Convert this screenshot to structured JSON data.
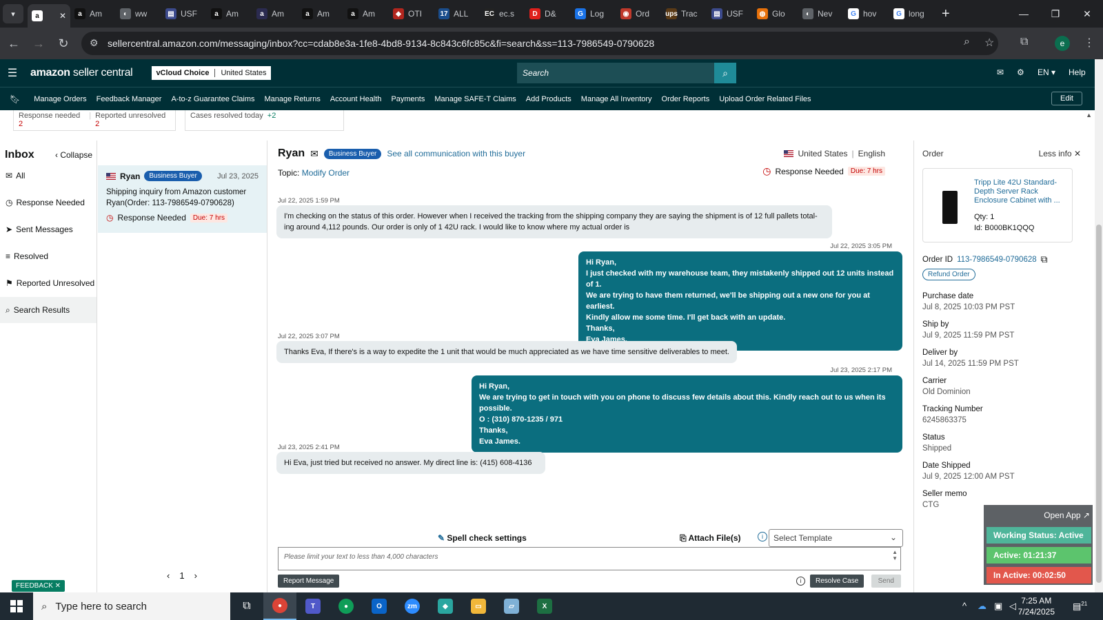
{
  "browser": {
    "tabs": [
      {
        "label": "Am",
        "icon": "a",
        "color": "#111111"
      },
      {
        "label": "ww",
        "icon": "◐",
        "color": "#5f6368"
      },
      {
        "label": "USF",
        "icon": "▤",
        "color": "#3c4a8c"
      },
      {
        "label": "Am",
        "icon": "a",
        "color": "#111111"
      },
      {
        "label": "Am",
        "icon": "a",
        "color": "#2b2b50"
      },
      {
        "label": "Am",
        "icon": "a",
        "color": "#111111"
      },
      {
        "label": "Am",
        "icon": "a",
        "color": "#111111"
      },
      {
        "label": "OTI",
        "icon": "◆",
        "color": "#b3261e"
      },
      {
        "label": "ALL",
        "icon": "17",
        "color": "#1a4d8c"
      },
      {
        "label": "ec.s",
        "icon": "EC",
        "color": "#222222"
      },
      {
        "label": "D&",
        "icon": "D",
        "color": "#e0201c"
      },
      {
        "label": "Log",
        "icon": "G",
        "color": "#1a73e8"
      },
      {
        "label": "Ord",
        "icon": "◉",
        "color": "#c0392b"
      },
      {
        "label": "Trac",
        "icon": "ups",
        "color": "#5a3a16"
      },
      {
        "label": "USF",
        "icon": "▤",
        "color": "#3c4a8c"
      },
      {
        "label": "Glo",
        "icon": "◍",
        "color": "#e8710a"
      },
      {
        "label": "Nev",
        "icon": "◐",
        "color": "#5f6368"
      },
      {
        "label": "hov",
        "icon": "G",
        "color": "#ffffff"
      },
      {
        "label": "long",
        "icon": "G",
        "color": "#ffffff"
      }
    ],
    "url": "sellercentral.amazon.com/messaging/inbox?cc=cdab8e3a-1fe8-4bd8-9134-8c843c6fc85c&fi=search&ss=113-7986549-0790628",
    "profile_initial": "e"
  },
  "header": {
    "logo_main": "amazon",
    "logo_sub": " seller central",
    "account_name": "vCloud Choice",
    "account_region": "United States",
    "search_placeholder": "Search",
    "language": "EN",
    "help": "Help"
  },
  "menu": {
    "items": [
      "Manage Orders",
      "Feedback Manager",
      "A-to-z Guarantee Claims",
      "Manage Returns",
      "Account Health",
      "Payments",
      "Manage SAFE-T Claims",
      "Add Products",
      "Manage All Inventory",
      "Order Reports",
      "Upload Order Related Files"
    ],
    "edit": "Edit"
  },
  "stats": {
    "response_needed_label": "Response needed",
    "response_needed_count": "2",
    "reported_unresolved_label": "Reported unresolved",
    "reported_unresolved_count": "2",
    "cases_resolved_label": "Cases resolved today",
    "cases_resolved_count": "+2"
  },
  "inbox": {
    "title": "Inbox",
    "collapse": "Collapse",
    "items": [
      {
        "label": "All",
        "icon": "✉"
      },
      {
        "label": "Response Needed",
        "icon": "◷"
      },
      {
        "label": "Sent Messages",
        "icon": "➤"
      },
      {
        "label": "Resolved",
        "icon": "≡"
      },
      {
        "label": "Reported Unresolved",
        "icon": "⚑"
      },
      {
        "label": "Search Results",
        "icon": "⌕"
      }
    ]
  },
  "thread": {
    "name": "Ryan",
    "badge": "Business Buyer",
    "date": "Jul 23, 2025",
    "snippet": "Shipping inquiry from Amazon customer Ryan(Order: 113-7986549-0790628)",
    "status": "Response Needed",
    "due": "Due: 7 hrs",
    "page": "1"
  },
  "feedback": "FEEDBACK ✕",
  "conversation": {
    "name": "Ryan",
    "badge": "Business Buyer",
    "see_all": "See all communication with this buyer",
    "topic_label": "Topic:",
    "topic": "Modify Order",
    "country": "United States",
    "language": "English",
    "status": "Response Needed",
    "due": "Due: 7 hrs",
    "messages": [
      {
        "ts": "Jul 22, 2025 1:59 PM",
        "text": "I'm checking on the status of this order. However when I received the tracking from the shipping company they are saying the shipment is of 12 full pallets total- ing around 4,112 pounds. Our order is only of 1 42U rack. I would like to know where my actual order is"
      },
      {
        "ts": "Jul 22, 2025 3:05 PM",
        "lines": [
          "Hi Ryan,",
          "I just checked with my warehouse team, they mistakenly shipped out 12 units instead of 1.",
          "We are trying to have them returned, we'll be shipping out a new one for you at earliest.",
          "Kindly allow me some time. I'll get back with an update.",
          "Thanks,",
          "Eva James."
        ]
      },
      {
        "ts": "Jul 22, 2025 3:07 PM",
        "text": "Thanks Eva, If there's is a way to expedite the 1 unit that would be much appreciated as we have time sensitive deliverables to meet."
      },
      {
        "ts": "Jul 23, 2025 2:17 PM",
        "lines": [
          "Hi Ryan,",
          "We are trying to get in touch with you on phone to discuss few details about this. Kindly reach out to us when its possible.",
          "O : (310) 870-1235 / 971",
          "Thanks,",
          "Eva James."
        ]
      },
      {
        "ts": "Jul 23, 2025 2:41 PM",
        "text": "Hi Eva, just tried but received no answer. My direct line is: (415) 608-4136"
      }
    ],
    "spell_check": "Spell check settings",
    "attach": "Attach File(s)",
    "template_placeholder": "Select Template",
    "textarea_placeholder": "Please limit your text to less than 4,000 characters",
    "report": "Report Message",
    "resolve": "Resolve Case",
    "send": "Send"
  },
  "order": {
    "title": "Order",
    "less_info": "Less info",
    "product_name": "Tripp Lite 42U Standard-Depth Server Rack Enclosure Cabinet with ...",
    "qty": "Qty: 1",
    "product_id": "Id: B000BK1QQQ",
    "order_id_label": "Order ID",
    "order_id": "113-7986549-0790628",
    "refund": "Refund Order",
    "fields": [
      {
        "label": "Purchase date",
        "value": "Jul 8, 2025 10:03 PM PST"
      },
      {
        "label": "Ship by",
        "value": "Jul 9, 2025 11:59 PM PST"
      },
      {
        "label": "Deliver by",
        "value": "Jul 14, 2025 11:59 PM PST"
      },
      {
        "label": "Carrier",
        "value": "Old Dominion"
      },
      {
        "label": "Tracking Number",
        "value": "6245863375"
      },
      {
        "label": "Status",
        "value": "Shipped"
      },
      {
        "label": "Date Shipped",
        "value": "Jul 9, 2025 12:00 AM PST"
      },
      {
        "label": "Seller memo",
        "value": "CTG"
      }
    ]
  },
  "widget": {
    "open_app": "Open App ↗",
    "working": "Working Status: Active",
    "active": "Active: 01:21:37",
    "inactive": "In Active: 00:02:50",
    "working_color": "#4fb59a",
    "active_color": "#5cc46d",
    "inactive_color": "#e2574c"
  },
  "taskbar": {
    "search_placeholder": "Type here to search",
    "time": "7:25 AM",
    "date": "7/24/2025",
    "notif": "21"
  }
}
